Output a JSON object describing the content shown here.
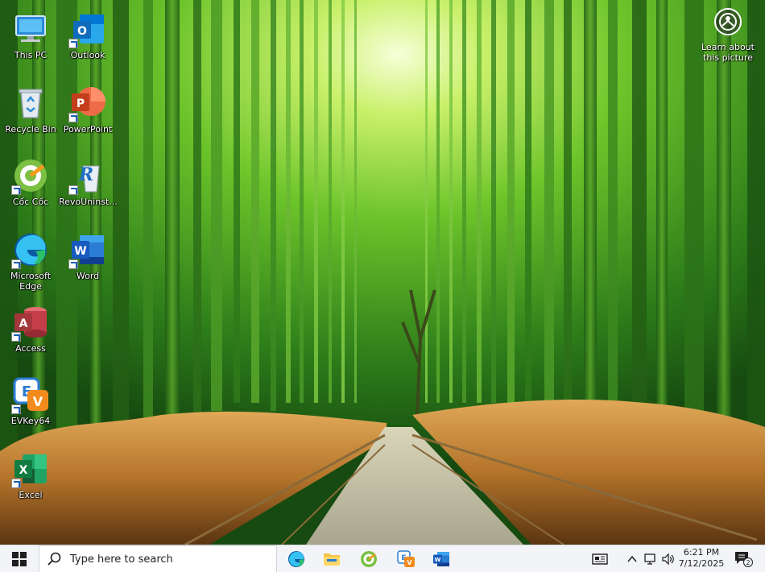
{
  "desktop": {
    "icons": [
      {
        "label": "This PC",
        "icon": "this-pc-icon"
      },
      {
        "label": "Outlook",
        "icon": "outlook-icon"
      },
      {
        "label": "Recycle Bin",
        "icon": "recycle-bin-icon"
      },
      {
        "label": "PowerPoint",
        "icon": "powerpoint-icon"
      },
      {
        "label": "Cốc Cốc",
        "icon": "coccoc-icon"
      },
      {
        "label": "RevoUninst...",
        "icon": "revo-uninstaller-icon"
      },
      {
        "label": "Microsoft Edge",
        "icon": "edge-icon"
      },
      {
        "label": "Word",
        "icon": "word-icon"
      },
      {
        "label": "Access",
        "icon": "access-icon"
      },
      {
        "label": "EVKey64",
        "icon": "evkey-icon"
      },
      {
        "label": "Excel",
        "icon": "excel-icon"
      }
    ],
    "learn_about_picture": "Learn about this picture"
  },
  "taskbar": {
    "search_placeholder": "Type here to search",
    "pinned_apps": [
      "Microsoft Edge",
      "File Explorer",
      "Cốc Cốc",
      "EVKey64",
      "Word"
    ],
    "clock_time": "6:21 PM",
    "clock_date": "7/12/2025",
    "notification_count": "2"
  },
  "colors": {
    "taskbar_bg": "#f2f4f7",
    "word_blue": "#185abd",
    "excel_green": "#107c41",
    "powerpoint_red": "#c43e1c",
    "access_red": "#a4373a",
    "outlook_blue": "#0f6cbd"
  }
}
